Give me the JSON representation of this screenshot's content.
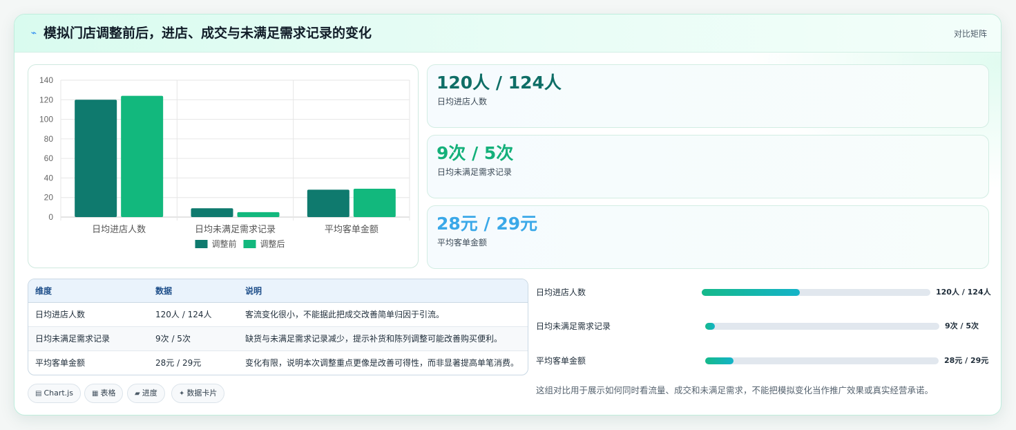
{
  "header": {
    "icon": "lightning-icon",
    "title": "模拟门店调整前后，进店、成交与未满足需求记录的变化",
    "tag": "对比矩阵"
  },
  "chart_data": {
    "type": "bar",
    "categories": [
      "日均进店人数",
      "日均未满足需求记录",
      "平均客单金额"
    ],
    "series": [
      {
        "name": "调整前",
        "values": [
          120,
          9,
          28
        ],
        "color": "#0f7a6e"
      },
      {
        "name": "调整后",
        "values": [
          124,
          5,
          29
        ],
        "color": "#12b87d"
      }
    ],
    "ylim": [
      0,
      140
    ],
    "yticks": [
      0,
      20,
      40,
      60,
      80,
      100,
      120,
      140
    ],
    "grid": true,
    "legend": "bottom"
  },
  "stats": [
    {
      "value": "120人 / 124人",
      "label": "日均进店人数",
      "color": "#0f6e66"
    },
    {
      "value": "9次 / 5次",
      "label": "日均未满足需求记录",
      "color": "#14b07a"
    },
    {
      "value": "28元 / 29元",
      "label": "平均客单金额",
      "color": "#3aa8e8"
    }
  ],
  "table": {
    "headers": [
      "维度",
      "数据",
      "说明"
    ],
    "rows": [
      [
        "日均进店人数",
        "120人 / 124人",
        "客流变化很小，不能据此把成交改善简单归因于引流。"
      ],
      [
        "日均未满足需求记录",
        "9次 / 5次",
        "缺货与未满足需求记录减少，提示补货和陈列调整可能改善购买便利。"
      ],
      [
        "平均客单金额",
        "28元 / 29元",
        "变化有限，说明本次调整重点更像是改善可得性，而非显著提高单笔消费。"
      ]
    ]
  },
  "chips": [
    {
      "icon": "chart-icon",
      "glyph": "▤",
      "label": "Chart.js"
    },
    {
      "icon": "table-icon",
      "glyph": "▦",
      "label": "表格"
    },
    {
      "icon": "progress-icon",
      "glyph": "▰",
      "label": "进度"
    },
    {
      "icon": "sparkle-icon",
      "glyph": "✦",
      "label": "数据卡片"
    }
  ],
  "progress": [
    {
      "label": "日均进店人数",
      "value": "120人 / 124人",
      "fill": 0.43
    },
    {
      "label": "日均未满足需求记录",
      "value": "9次 / 5次",
      "fill": 0.04
    },
    {
      "label": "平均客单金额",
      "value": "28元 / 29元",
      "fill": 0.12
    }
  ],
  "note": "这组对比用于展示如何同时看流量、成交和未满足需求，不能把模拟变化当作推广效果或真实经营承诺。"
}
